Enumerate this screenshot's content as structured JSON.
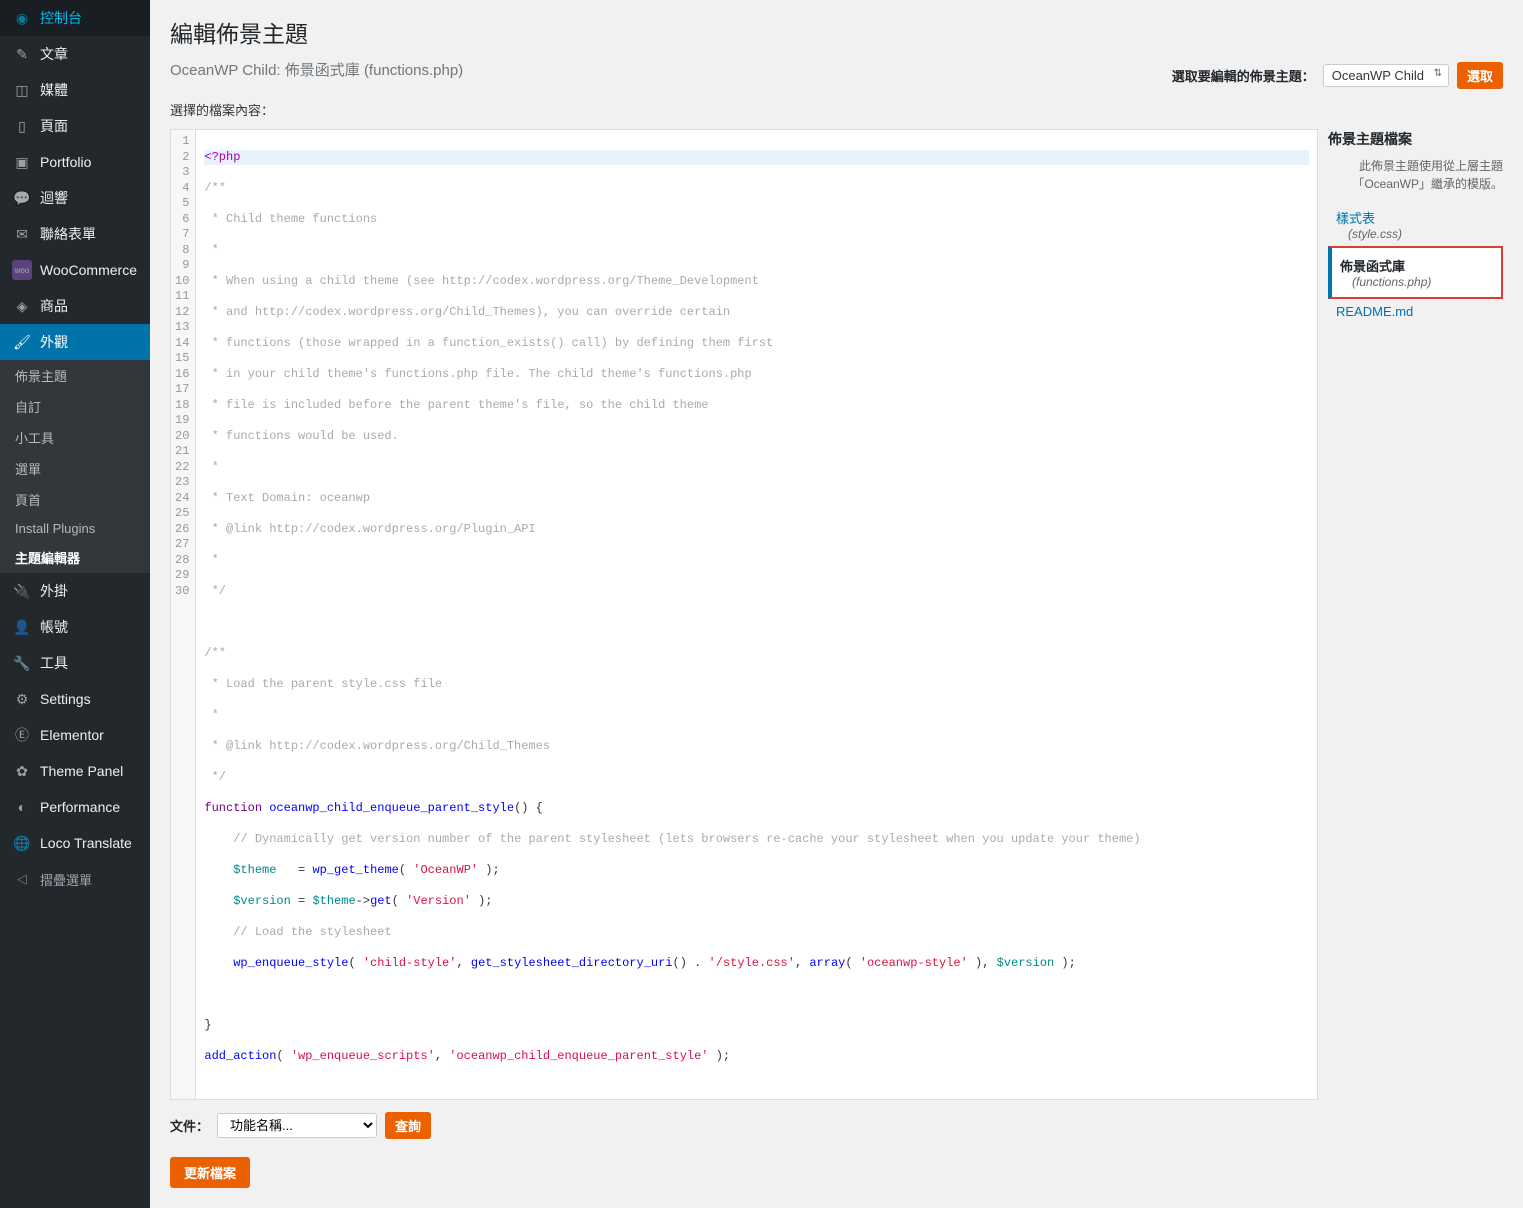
{
  "sidebar": {
    "items": [
      {
        "icon": "dashboard",
        "label": "控制台"
      },
      {
        "icon": "pin",
        "label": "文章"
      },
      {
        "icon": "media",
        "label": "媒體"
      },
      {
        "icon": "page",
        "label": "頁面"
      },
      {
        "icon": "portfolio",
        "label": "Portfolio"
      },
      {
        "icon": "comment",
        "label": "迴響"
      },
      {
        "icon": "mail",
        "label": "聯絡表單"
      },
      {
        "icon": "woo",
        "label": "WooCommerce"
      },
      {
        "icon": "product",
        "label": "商品"
      },
      {
        "icon": "appearance",
        "label": "外觀"
      },
      {
        "icon": "plugin",
        "label": "外掛"
      },
      {
        "icon": "user",
        "label": "帳號"
      },
      {
        "icon": "tool",
        "label": "工具"
      },
      {
        "icon": "settings",
        "label": "Settings"
      },
      {
        "icon": "elementor",
        "label": "Elementor"
      },
      {
        "icon": "themepanel",
        "label": "Theme Panel"
      },
      {
        "icon": "performance",
        "label": "Performance"
      },
      {
        "icon": "loco",
        "label": "Loco Translate"
      }
    ],
    "sub_items": [
      "佈景主題",
      "自訂",
      "小工具",
      "選單",
      "頁首",
      "Install Plugins",
      "主題編輯器"
    ],
    "collapse_label": "摺疊選單"
  },
  "page": {
    "title": "編輯佈景主題",
    "subtitle": "OceanWP Child: 佈景函式庫 (functions.php)",
    "select_theme_label": "選取要編輯的佈景主題：",
    "theme_selected": "OceanWP Child",
    "select_button": "選取",
    "select_file_label": "選擇的檔案內容：",
    "files_panel_title": "佈景主題檔案",
    "files_panel_note": "此佈景主題使用從上層主題「OceanWP」繼承的模版。",
    "files": [
      {
        "label": "樣式表",
        "sub": "(style.css)"
      },
      {
        "label": "佈景函式庫",
        "sub": "(functions.php)"
      },
      {
        "label": "README.md",
        "sub": ""
      }
    ],
    "doc_label": "文件：",
    "func_placeholder": "功能名稱...",
    "lookup_button": "查詢",
    "update_button": "更新檔案"
  },
  "code_lines": {
    "l1": "<?php",
    "l2": "/**",
    "l3": " * Child theme functions",
    "l4": " *",
    "l5": " * When using a child theme (see http://codex.wordpress.org/Theme_Development",
    "l6": " * and http://codex.wordpress.org/Child_Themes), you can override certain",
    "l7": " * functions (those wrapped in a function_exists() call) by defining them first",
    "l8": " * in your child theme's functions.php file. The child theme's functions.php",
    "l9": " * file is included before the parent theme's file, so the child theme",
    "l10": " * functions would be used.",
    "l11": " *",
    "l12": " * Text Domain: oceanwp",
    "l13": " * @link http://codex.wordpress.org/Plugin_API",
    "l14": " *",
    "l15": " */",
    "l16": "",
    "l17": "/**",
    "l18": " * Load the parent style.css file",
    "l19": " *",
    "l20": " * @link http://codex.wordpress.org/Child_Themes",
    "l21": " */",
    "l29": "}"
  }
}
